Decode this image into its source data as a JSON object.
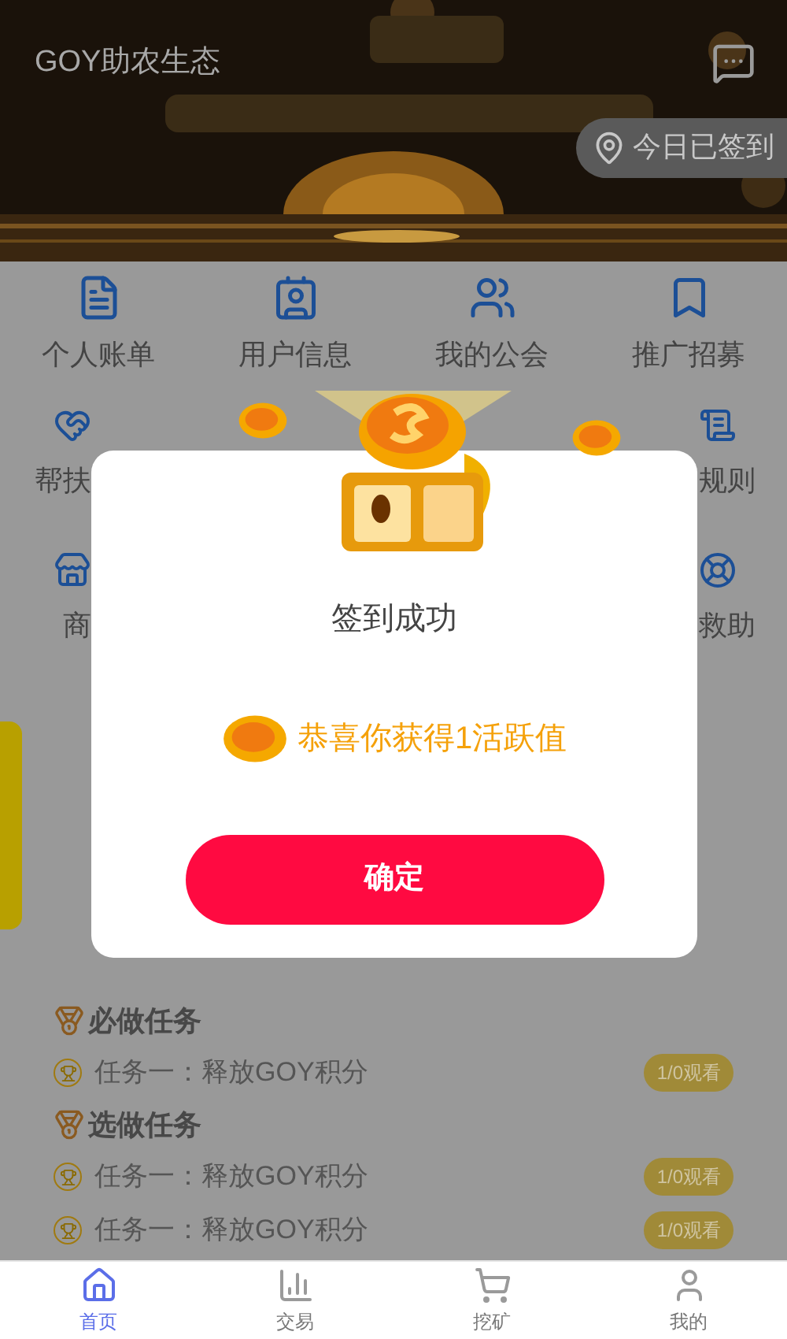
{
  "header": {
    "title": "GOY助农生态",
    "checkin": "今日已签到"
  },
  "menu": {
    "top": [
      "个人账单",
      "用户信息",
      "我的公会",
      "推广招募"
    ],
    "rows": [
      {
        "left": "帮扶",
        "right": "规则"
      },
      {
        "left": "商",
        "right": "救助"
      }
    ]
  },
  "sections": [
    {
      "title": "必做任务",
      "tasks": [
        {
          "name": "任务一：释放GOY积分",
          "badge": "1/0观看"
        }
      ]
    },
    {
      "title": "选做任务",
      "tasks": [
        {
          "name": "任务一：释放GOY积分",
          "badge": "1/0观看"
        },
        {
          "name": "任务一：释放GOY积分",
          "badge": "1/0观看"
        }
      ]
    }
  ],
  "modal": {
    "title": "签到成功",
    "reward": "恭喜你获得1活跃值",
    "button": "确定"
  },
  "nav": [
    {
      "label": "首页",
      "selected": true
    },
    {
      "label": "交易",
      "selected": false
    },
    {
      "label": "挖矿",
      "selected": false
    },
    {
      "label": "我的",
      "selected": false
    }
  ]
}
